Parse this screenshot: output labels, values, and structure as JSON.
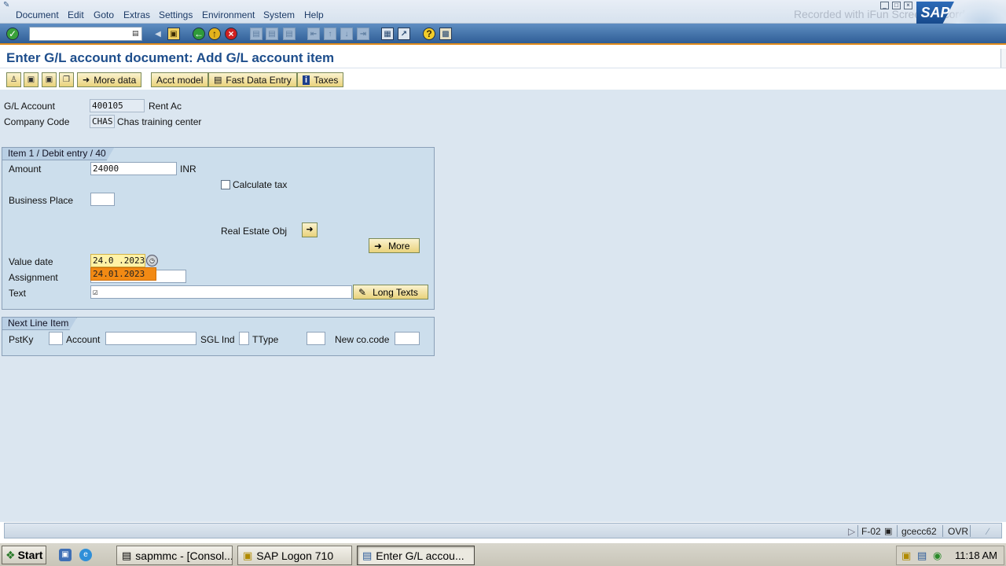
{
  "menubar": {
    "items": [
      "Document",
      "Edit",
      "Goto",
      "Extras",
      "Settings",
      "Environment",
      "System",
      "Help"
    ],
    "watermark": "Recorded with iFun Screen Recorder"
  },
  "toolbar": {
    "icons": [
      "enter-icon",
      "save-icon",
      "back-icon",
      "exit-icon",
      "cancel-icon",
      "print-icon",
      "find-icon",
      "find-next-icon",
      "first-page-icon",
      "previous-page-icon",
      "next-page-icon",
      "last-page-icon",
      "create-session-icon",
      "shortcut-icon",
      "help-icon",
      "layout-icon"
    ],
    "command_value": ""
  },
  "title": "Enter G/L account document: Add G/L account item",
  "app_toolbar": {
    "more_data": "More data",
    "acct_model": "Acct model",
    "fast_data_entry": "Fast Data Entry",
    "taxes": "Taxes"
  },
  "header": {
    "gl_account_label": "G/L Account",
    "gl_account_value": "400105",
    "gl_account_desc": "Rent Ac",
    "company_code_label": "Company Code",
    "company_code_value": "CHAS",
    "company_code_desc": "Chas training center"
  },
  "item": {
    "frame_title": "Item 1 / Debit entry / 40",
    "amount_label": "Amount",
    "amount_value": "24000",
    "currency": "INR",
    "calculate_tax_label": "Calculate tax",
    "calculate_tax_checked": false,
    "business_place_label": "Business Place",
    "business_place_value": "",
    "real_estate_label": "Real Estate Obj",
    "more_label": "More",
    "value_date_label": "Value date",
    "value_date_value": "24.0 .2023",
    "value_date_suggestion": "24.01.2023",
    "assignment_label": "Assignment",
    "assignment_value": "",
    "text_label": "Text",
    "text_value": "☑",
    "long_texts_label": "Long Texts"
  },
  "next_line": {
    "frame_title": "Next Line Item",
    "pstky_label": "PstKy",
    "account_label": "Account",
    "sgl_ind_label": "SGL Ind",
    "ttype_label": "TType",
    "new_cocode_label": "New co.code"
  },
  "statusbar": {
    "transaction": "F-02",
    "server": "gcecc62",
    "mode": "OVR"
  },
  "taskbar": {
    "start": "Start",
    "tasks": [
      "sapmmc - [Consol...",
      "SAP Logon 710",
      "Enter G/L accou..."
    ],
    "clock": "11:18 AM"
  }
}
